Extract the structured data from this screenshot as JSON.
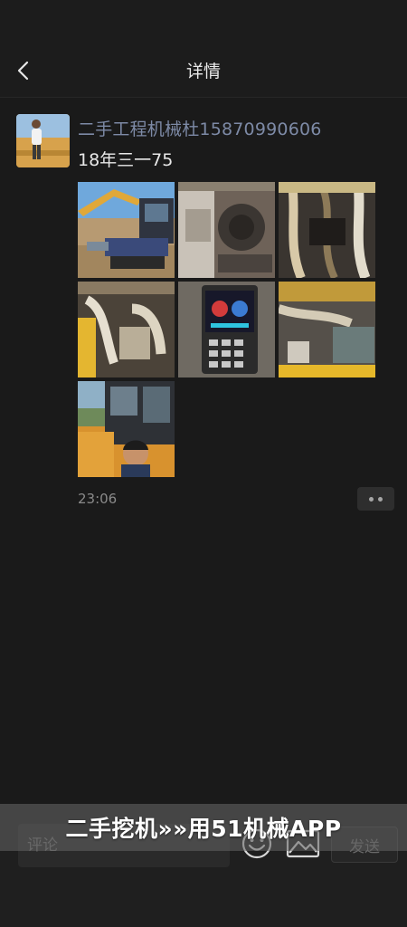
{
  "header": {
    "title": "详情"
  },
  "post": {
    "username": "二手工程机械杜15870990606",
    "text": "18年三一75",
    "time": "23:06",
    "photos": [
      {
        "name": "photo-excavator-site"
      },
      {
        "name": "photo-engine-bay"
      },
      {
        "name": "photo-hydraulic-hoses"
      },
      {
        "name": "photo-hydraulic-valves"
      },
      {
        "name": "photo-control-panel"
      },
      {
        "name": "photo-engine-side"
      },
      {
        "name": "photo-cab-selfie"
      }
    ]
  },
  "footer": {
    "comment_placeholder": "评论",
    "send_label": "发送"
  },
  "watermark": {
    "text": "二手挖机»»用51机械APP"
  },
  "colors": {
    "background": "#1a1a1a",
    "username": "#7d8aa6",
    "accent_orange": "#e8a030"
  }
}
